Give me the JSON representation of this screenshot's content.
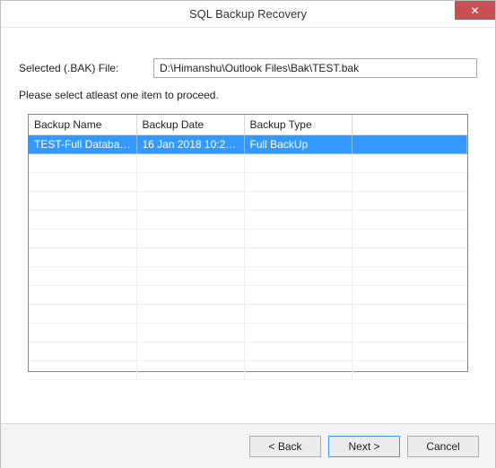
{
  "window": {
    "title": "SQL Backup Recovery"
  },
  "form": {
    "file_label": "Selected (.BAK) File:",
    "file_value": "D:\\Himanshu\\Outlook Files\\Bak\\TEST.bak",
    "instruction": "Please select atleast one item to proceed."
  },
  "grid": {
    "columns": {
      "name": "Backup Name",
      "date": "Backup Date",
      "type": "Backup Type"
    },
    "rows": [
      {
        "name": "TEST-Full Database ...",
        "date": "16 Jan 2018 10:29:...",
        "type": "Full BackUp",
        "selected": true
      }
    ]
  },
  "buttons": {
    "back": "< Back",
    "next": "Next >",
    "cancel": "Cancel"
  }
}
